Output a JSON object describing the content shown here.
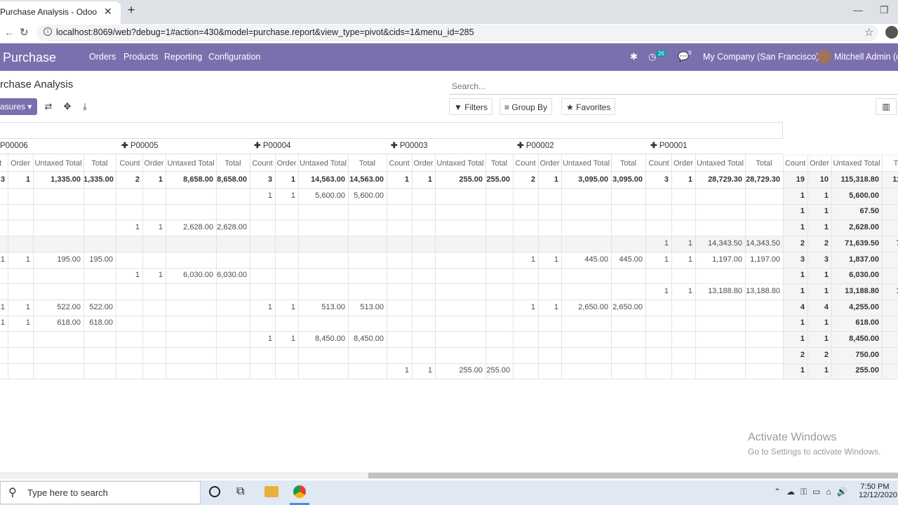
{
  "browser": {
    "tab_title": "Purchase Analysis - Odoo",
    "tab_close": "✕",
    "new_tab": "+",
    "url": "localhost:8069/web?debug=1#action=430&model=purchase.report&view_type=pivot&cids=1&menu_id=285"
  },
  "navbar": {
    "brand": "Purchase",
    "menu": [
      "Orders",
      "Products",
      "Reporting",
      "Configuration"
    ],
    "activity_count": "26",
    "message_count": "9",
    "company": "My Company (San Francisco)",
    "user": "Mitchell Admin (odo"
  },
  "control_panel": {
    "breadcrumb": "rchase Analysis",
    "search_placeholder": "Search...",
    "measures_label": "asures",
    "filters_label": "Filters",
    "groupby_label": "Group By",
    "favorites_label": "Favorites"
  },
  "pivot": {
    "column_groups": [
      "P00006",
      "P00005",
      "P00004",
      "P00003",
      "P00002",
      "P00001"
    ],
    "measure_headers": [
      "Count",
      "Order",
      "Untaxed Total",
      "Total"
    ],
    "first_count_header": "unt",
    "last_header": "T",
    "rows": [
      {
        "bold": true,
        "cells": [
          "3",
          "1",
          "1,335.00",
          "1,335.00",
          "2",
          "1",
          "8,658.00",
          "8,658.00",
          "3",
          "1",
          "14,563.00",
          "14,563.00",
          "1",
          "1",
          "255.00",
          "255.00",
          "2",
          "1",
          "3,095.00",
          "3,095.00",
          "3",
          "1",
          "28,729.30",
          "28,729.30"
        ],
        "totals": [
          "19",
          "10",
          "115,318.80",
          "115,"
        ]
      },
      {
        "bold": false,
        "cells": [
          "",
          "",
          "",
          "",
          "",
          "",
          "",
          "",
          "1",
          "1",
          "5,600.00",
          "5,600.00",
          "",
          "",
          "",
          "",
          "",
          "",
          "",
          "",
          "",
          "",
          "",
          ""
        ],
        "totals": [
          "1",
          "1",
          "5,600.00",
          "5,"
        ]
      },
      {
        "bold": false,
        "cells": [
          "",
          "",
          "",
          "",
          "",
          "",
          "",
          "",
          "",
          "",
          "",
          "",
          "",
          "",
          "",
          "",
          "",
          "",
          "",
          "",
          "",
          "",
          "",
          ""
        ],
        "totals": [
          "1",
          "1",
          "67.50",
          ""
        ]
      },
      {
        "bold": false,
        "cells": [
          "",
          "",
          "",
          "",
          "1",
          "1",
          "2,628.00",
          "2,628.00",
          "",
          "",
          "",
          "",
          "",
          "",
          "",
          "",
          "",
          "",
          "",
          "",
          "",
          "",
          "",
          ""
        ],
        "totals": [
          "1",
          "1",
          "2,628.00",
          "2,"
        ]
      },
      {
        "bold": false,
        "cells": [
          "",
          "",
          "",
          "",
          "",
          "",
          "",
          "",
          "",
          "",
          "",
          "",
          "",
          "",
          "",
          "",
          "",
          "",
          "",
          "",
          "1",
          "1",
          "14,343.50",
          "14,343.50"
        ],
        "totals": [
          "2",
          "2",
          "71,639.50",
          "71,"
        ]
      },
      {
        "bold": false,
        "cells": [
          "1",
          "1",
          "195.00",
          "195.00",
          "",
          "",
          "",
          "",
          "",
          "",
          "",
          "",
          "",
          "",
          "",
          "",
          "1",
          "1",
          "445.00",
          "445.00",
          "1",
          "1",
          "1,197.00",
          "1,197.00"
        ],
        "totals": [
          "3",
          "3",
          "1,837.00",
          "1,"
        ]
      },
      {
        "bold": false,
        "cells": [
          "",
          "",
          "",
          "",
          "1",
          "1",
          "6,030.00",
          "6,030.00",
          "",
          "",
          "",
          "",
          "",
          "",
          "",
          "",
          "",
          "",
          "",
          "",
          "",
          "",
          "",
          ""
        ],
        "totals": [
          "1",
          "1",
          "6,030.00",
          "6,"
        ]
      },
      {
        "bold": false,
        "cells": [
          "",
          "",
          "",
          "",
          "",
          "",
          "",
          "",
          "",
          "",
          "",
          "",
          "",
          "",
          "",
          "",
          "",
          "",
          "",
          "",
          "1",
          "1",
          "13,188.80",
          "13,188.80"
        ],
        "totals": [
          "1",
          "1",
          "13,188.80",
          "13,"
        ]
      },
      {
        "bold": false,
        "cells": [
          "1",
          "1",
          "522.00",
          "522.00",
          "",
          "",
          "",
          "",
          "1",
          "1",
          "513.00",
          "513.00",
          "",
          "",
          "",
          "",
          "1",
          "1",
          "2,650.00",
          "2,650.00",
          "",
          "",
          "",
          ""
        ],
        "totals": [
          "4",
          "4",
          "4,255.00",
          "4,"
        ]
      },
      {
        "bold": false,
        "cells": [
          "1",
          "1",
          "618.00",
          "618.00",
          "",
          "",
          "",
          "",
          "",
          "",
          "",
          "",
          "",
          "",
          "",
          "",
          "",
          "",
          "",
          "",
          "",
          "",
          "",
          ""
        ],
        "totals": [
          "1",
          "1",
          "618.00",
          ""
        ]
      },
      {
        "bold": false,
        "cells": [
          "",
          "",
          "",
          "",
          "",
          "",
          "",
          "",
          "1",
          "1",
          "8,450.00",
          "8,450.00",
          "",
          "",
          "",
          "",
          "",
          "",
          "",
          "",
          "",
          "",
          "",
          ""
        ],
        "totals": [
          "1",
          "1",
          "8,450.00",
          "8,"
        ]
      },
      {
        "bold": false,
        "cells": [
          "",
          "",
          "",
          "",
          "",
          "",
          "",
          "",
          "",
          "",
          "",
          "",
          "",
          "",
          "",
          "",
          "",
          "",
          "",
          "",
          "",
          "",
          "",
          ""
        ],
        "totals": [
          "2",
          "2",
          "750.00",
          ""
        ]
      },
      {
        "bold": false,
        "cells": [
          "",
          "",
          "",
          "",
          "",
          "",
          "",
          "",
          "",
          "",
          "",
          "",
          "1",
          "1",
          "255.00",
          "255.00",
          "",
          "",
          "",
          "",
          "",
          "",
          "",
          ""
        ],
        "totals": [
          "1",
          "1",
          "255.00",
          ""
        ]
      }
    ]
  },
  "watermark": {
    "title": "Activate Windows",
    "subtitle": "Go to Settings to activate Windows."
  },
  "taskbar": {
    "search_text": "Type here to search",
    "time": "7:50 PM",
    "date": "12/12/2020"
  }
}
